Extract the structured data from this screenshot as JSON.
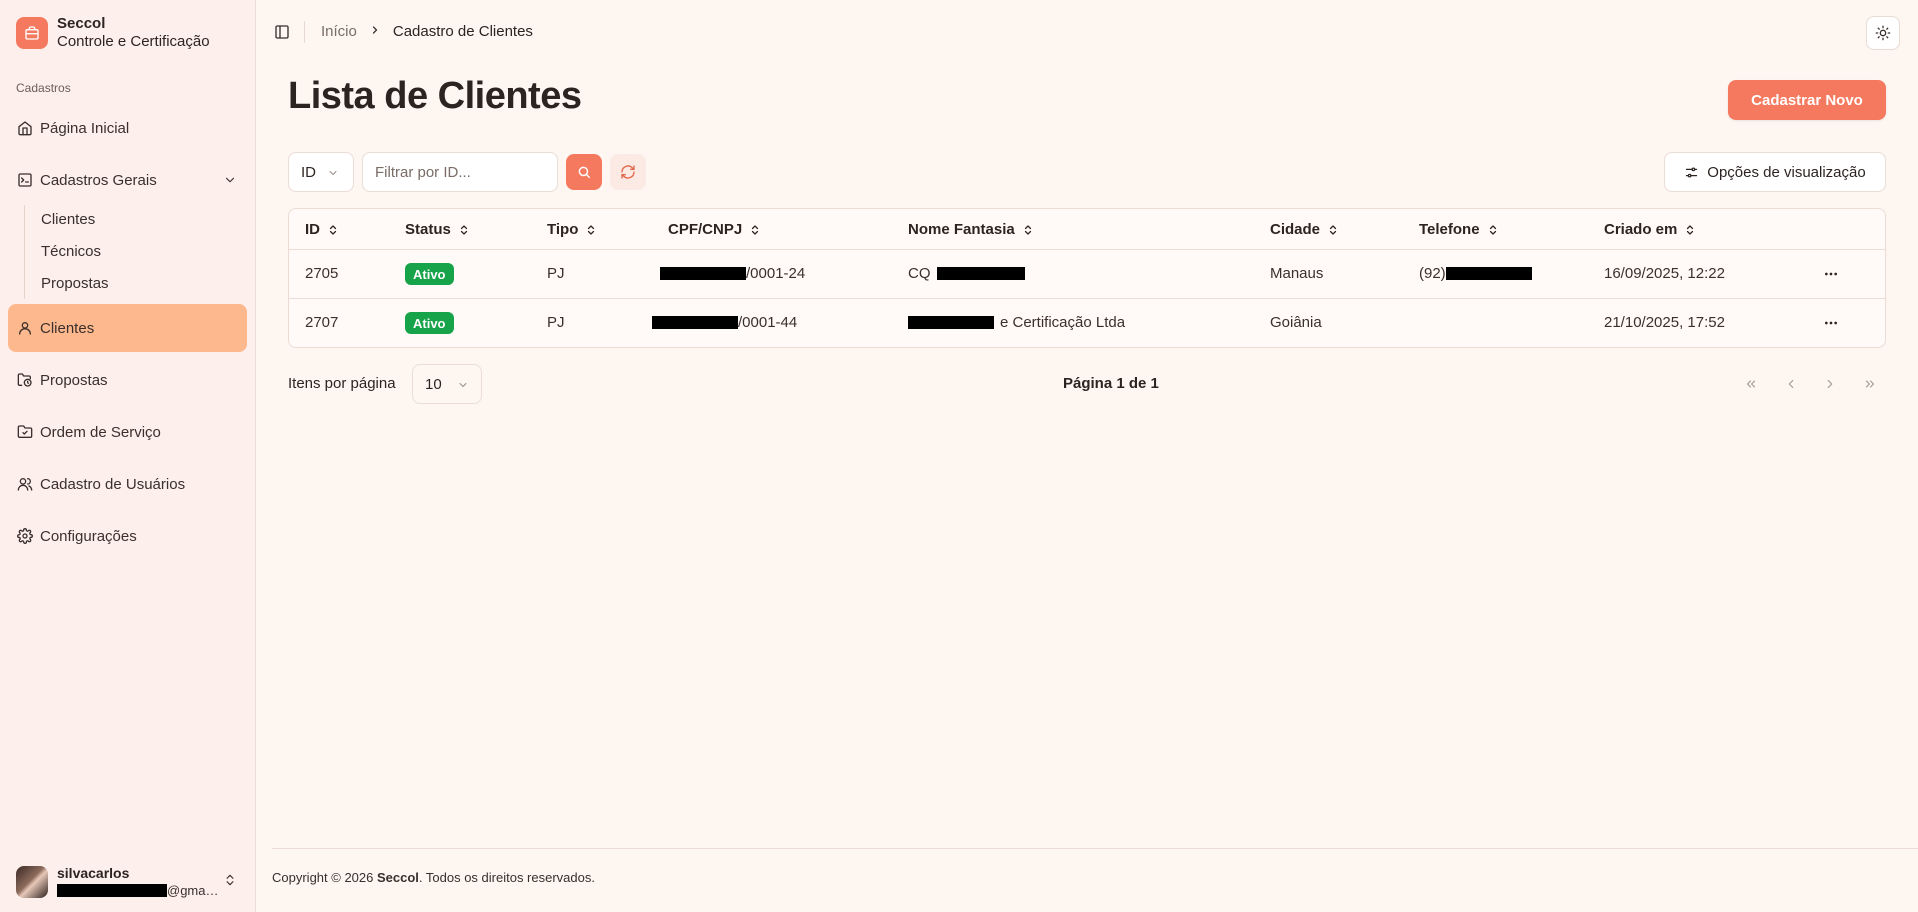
{
  "brand": {
    "name": "Seccol",
    "subtitle": "Controle e Certificação"
  },
  "sidebar": {
    "section_label": "Cadastros",
    "items": [
      {
        "label": "Página Inicial",
        "icon": "home-icon"
      },
      {
        "label": "Cadastros Gerais",
        "icon": "terminal-square-icon",
        "expanded": true,
        "children": [
          "Clientes",
          "Técnicos",
          "Propostas"
        ]
      },
      {
        "label": "Clientes",
        "icon": "user-icon",
        "active": true
      },
      {
        "label": "Propostas",
        "icon": "folder-clock-icon"
      },
      {
        "label": "Ordem de Serviço",
        "icon": "folder-check-icon"
      },
      {
        "label": "Cadastro de Usuários",
        "icon": "users-icon"
      },
      {
        "label": "Configurações",
        "icon": "settings-icon"
      }
    ],
    "user": {
      "name": "silvacarlos",
      "email_suffix": "@gma…"
    }
  },
  "header": {
    "breadcrumb": [
      "Início",
      "Cadastro de Clientes"
    ]
  },
  "page": {
    "title": "Lista de Clientes",
    "new_button": "Cadastrar Novo",
    "filter": {
      "field": "ID",
      "placeholder": "Filtrar por ID..."
    },
    "view_options": "Opções de visualização"
  },
  "table": {
    "columns": [
      "ID",
      "Status",
      "Tipo",
      "CPF/CNPJ",
      "Nome Fantasia",
      "Cidade",
      "Telefone",
      "Criado em"
    ],
    "rows": [
      {
        "id": "2705",
        "status": "Ativo",
        "tipo": "PJ",
        "cnpj_suffix": "/0001-24",
        "nome_prefix": "CQ",
        "nome_suffix": "",
        "cidade": "Manaus",
        "telefone_prefix": "(92)",
        "criado": "16/09/2025, 12:22"
      },
      {
        "id": "2707",
        "status": "Ativo",
        "tipo": "PJ",
        "cnpj_suffix": "/0001-44",
        "nome_prefix": "",
        "nome_suffix": "e Certificação Ltda",
        "cidade": "Goiânia",
        "telefone_prefix": "",
        "criado": "21/10/2025, 17:52"
      }
    ]
  },
  "pagination": {
    "per_page_label": "Itens por página",
    "per_page_value": "10",
    "page_info": "Página 1 de 1"
  },
  "footer": {
    "prefix": "Copyright © 2026",
    "brand": "Seccol",
    "suffix": ". Todos os direitos reservados."
  },
  "colors": {
    "accent": "#f5795e",
    "active_nav": "#fdb98d",
    "badge": "#16a34a",
    "background": "#fdf6f1"
  }
}
